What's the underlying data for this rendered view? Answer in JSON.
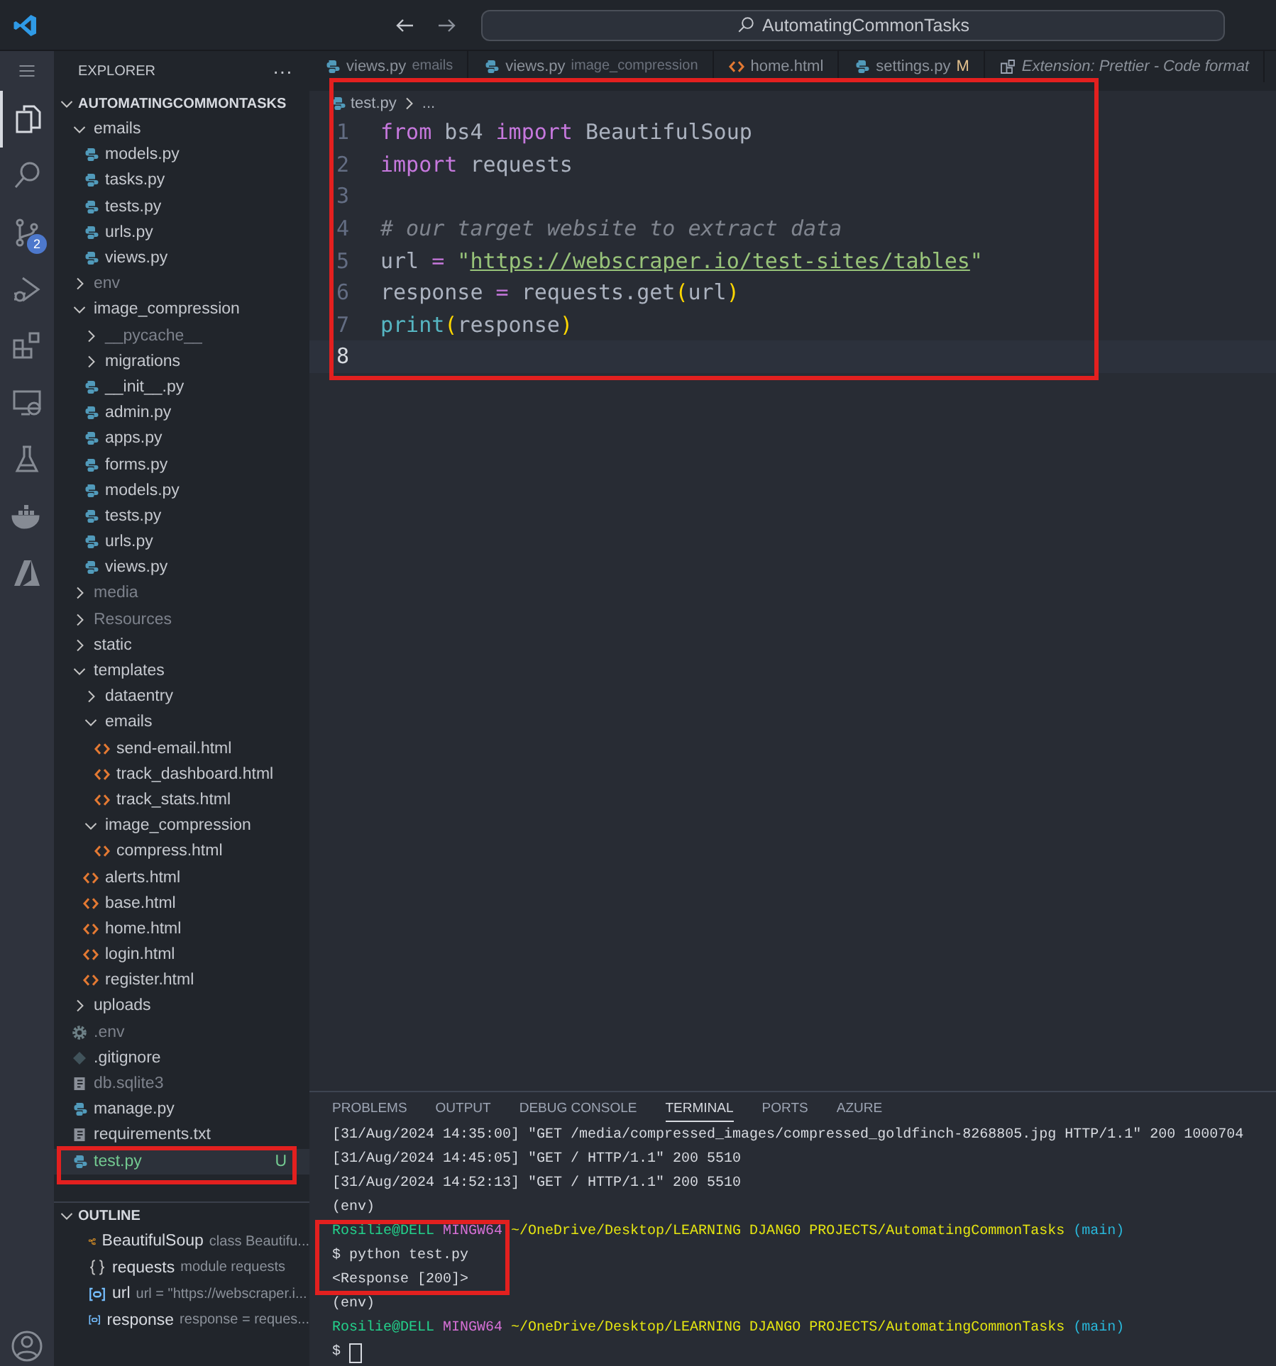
{
  "title_bar": {
    "search": "AutomatingCommonTasks"
  },
  "activity_bar": [
    {
      "kind": "explorer",
      "selected": true
    },
    {
      "kind": "search",
      "selected": false
    },
    {
      "kind": "source-control",
      "selected": false,
      "badge": "2"
    },
    {
      "kind": "run-debug",
      "selected": false
    },
    {
      "kind": "extensions",
      "selected": false
    },
    {
      "kind": "remote",
      "selected": false
    },
    {
      "kind": "testing",
      "selected": false
    },
    {
      "kind": "docker",
      "selected": false
    },
    {
      "kind": "azure",
      "selected": false
    }
  ],
  "sidebar": {
    "title": "EXPLORER",
    "more": "···",
    "folder": {
      "label": "AUTOMATINGCOMMONTASKS",
      "expanded": true
    },
    "tree": [
      {
        "label": "emails",
        "kind": "folder",
        "expanded": true,
        "dimmed": false,
        "selected": false,
        "children": [
          {
            "label": "models.py",
            "kind": "python",
            "dimmed": false,
            "selected": false
          },
          {
            "label": "tasks.py",
            "kind": "python",
            "dimmed": false,
            "selected": false
          },
          {
            "label": "tests.py",
            "kind": "python",
            "dimmed": false,
            "selected": false
          },
          {
            "label": "urls.py",
            "kind": "python",
            "dimmed": false,
            "selected": false
          },
          {
            "label": "views.py",
            "kind": "python",
            "dimmed": false,
            "selected": false
          }
        ]
      },
      {
        "label": "env",
        "kind": "folder",
        "expanded": false,
        "dimmed": true,
        "selected": false
      },
      {
        "label": "image_compression",
        "kind": "folder",
        "expanded": true,
        "dimmed": false,
        "selected": false,
        "children": [
          {
            "label": "__pycache__",
            "kind": "folder",
            "expanded": false,
            "dimmed": true,
            "selected": false
          },
          {
            "label": "migrations",
            "kind": "folder",
            "expanded": false,
            "dimmed": false,
            "selected": false
          },
          {
            "label": "__init__.py",
            "kind": "python",
            "dimmed": false,
            "selected": false
          },
          {
            "label": "admin.py",
            "kind": "python",
            "dimmed": false,
            "selected": false
          },
          {
            "label": "apps.py",
            "kind": "python",
            "dimmed": false,
            "selected": false
          },
          {
            "label": "forms.py",
            "kind": "python",
            "dimmed": false,
            "selected": false
          },
          {
            "label": "models.py",
            "kind": "python",
            "dimmed": false,
            "selected": false
          },
          {
            "label": "tests.py",
            "kind": "python",
            "dimmed": false,
            "selected": false
          },
          {
            "label": "urls.py",
            "kind": "python",
            "dimmed": false,
            "selected": false
          },
          {
            "label": "views.py",
            "kind": "python",
            "dimmed": false,
            "selected": false
          }
        ]
      },
      {
        "label": "media",
        "kind": "folder",
        "expanded": false,
        "dimmed": true,
        "selected": false
      },
      {
        "label": "Resources",
        "kind": "folder",
        "expanded": false,
        "dimmed": true,
        "selected": false
      },
      {
        "label": "static",
        "kind": "folder",
        "expanded": false,
        "dimmed": false,
        "selected": false
      },
      {
        "label": "templates",
        "kind": "folder",
        "expanded": true,
        "dimmed": false,
        "selected": false,
        "children": [
          {
            "label": "dataentry",
            "kind": "folder",
            "expanded": false,
            "dimmed": false,
            "selected": false
          },
          {
            "label": "emails",
            "kind": "folder",
            "expanded": true,
            "dimmed": false,
            "selected": false,
            "children": [
              {
                "label": "send-email.html",
                "kind": "html",
                "dimmed": false,
                "selected": false
              },
              {
                "label": "track_dashboard.html",
                "kind": "html",
                "dimmed": false,
                "selected": false
              },
              {
                "label": "track_stats.html",
                "kind": "html",
                "dimmed": false,
                "selected": false
              }
            ]
          },
          {
            "label": "image_compression",
            "kind": "folder",
            "expanded": true,
            "dimmed": false,
            "selected": false,
            "children": [
              {
                "label": "compress.html",
                "kind": "html",
                "dimmed": false,
                "selected": false
              }
            ]
          },
          {
            "label": "alerts.html",
            "kind": "html",
            "dimmed": false,
            "selected": false
          },
          {
            "label": "base.html",
            "kind": "html",
            "dimmed": false,
            "selected": false
          },
          {
            "label": "home.html",
            "kind": "html",
            "dimmed": false,
            "selected": false
          },
          {
            "label": "login.html",
            "kind": "html",
            "dimmed": false,
            "selected": false
          },
          {
            "label": "register.html",
            "kind": "html",
            "dimmed": false,
            "selected": false
          }
        ]
      },
      {
        "label": "uploads",
        "kind": "folder",
        "expanded": false,
        "dimmed": false,
        "selected": false
      },
      {
        "label": ".env",
        "kind": "settings",
        "dimmed": true,
        "selected": false
      },
      {
        "label": ".gitignore",
        "kind": "git",
        "dimmed": false,
        "selected": false
      },
      {
        "label": "db.sqlite3",
        "kind": "text",
        "dimmed": true,
        "selected": false
      },
      {
        "label": "manage.py",
        "kind": "python",
        "dimmed": false,
        "selected": false
      },
      {
        "label": "requirements.txt",
        "kind": "text",
        "dimmed": false,
        "selected": false
      },
      {
        "label": "test.py",
        "kind": "python",
        "dimmed": false,
        "selected": true,
        "badge": "U"
      }
    ],
    "outline": {
      "title": "OUTLINE",
      "expanded": true,
      "items": [
        {
          "kind": "class",
          "name": "BeautifulSoup",
          "detail": "class Beautifu..."
        },
        {
          "kind": "module",
          "name": "requests",
          "detail": "module requests"
        },
        {
          "kind": "variable",
          "name": "url",
          "detail": "url = \"https://webscraper.i..."
        },
        {
          "kind": "variable",
          "name": "response",
          "detail": "response = reques..."
        }
      ]
    }
  },
  "editor": {
    "tabs": [
      {
        "label": "views.py",
        "description": "emails",
        "kind": "python",
        "selected": false,
        "preview": false
      },
      {
        "label": "views.py",
        "description": "image_compression",
        "kind": "python",
        "selected": false,
        "preview": false
      },
      {
        "label": "home.html",
        "kind": "html",
        "selected": false,
        "preview": false
      },
      {
        "label": "settings.py",
        "badge": "M",
        "kind": "python",
        "selected": false,
        "preview": false
      },
      {
        "label": "Extension: Prettier - Code format",
        "kind": "extension",
        "selected": false,
        "preview": true
      }
    ],
    "breadcrumb": [
      "test.py",
      "..."
    ],
    "lines": [
      {
        "number": "1",
        "current": false,
        "tokens": [
          {
            "text": "from",
            "kind": "keyword"
          },
          {
            "text": " bs4 ",
            "kind": "plain"
          },
          {
            "text": "import",
            "kind": "keyword"
          },
          {
            "text": " BeautifulSoup",
            "kind": "plain"
          }
        ]
      },
      {
        "number": "2",
        "current": false,
        "tokens": [
          {
            "text": "import",
            "kind": "keyword"
          },
          {
            "text": " requests",
            "kind": "plain"
          }
        ]
      },
      {
        "number": "3",
        "current": false
      },
      {
        "number": "4",
        "current": false,
        "tokens": [
          {
            "text": "# our target website to extract data",
            "kind": "comment"
          }
        ]
      },
      {
        "number": "5",
        "current": false,
        "tokens": [
          {
            "text": "url ",
            "kind": "plain"
          },
          {
            "text": "=",
            "kind": "operator"
          },
          {
            "text": " \"",
            "kind": "string"
          },
          {
            "text": "https://webscraper.io/test-sites/tables",
            "kind": "link"
          },
          {
            "text": "\"",
            "kind": "string"
          }
        ]
      },
      {
        "number": "6",
        "current": false,
        "tokens": [
          {
            "text": "response ",
            "kind": "plain"
          },
          {
            "text": "=",
            "kind": "operator"
          },
          {
            "text": " requests.get",
            "kind": "plain"
          },
          {
            "text": "(",
            "kind": "bracket"
          },
          {
            "text": "url",
            "kind": "plain"
          },
          {
            "text": ")",
            "kind": "bracket"
          }
        ]
      },
      {
        "number": "7",
        "current": false,
        "tokens": [
          {
            "text": "print",
            "kind": "function"
          },
          {
            "text": "(",
            "kind": "bracket"
          },
          {
            "text": "response",
            "kind": "plain"
          },
          {
            "text": ")",
            "kind": "bracket"
          }
        ]
      },
      {
        "number": "8",
        "current": true
      }
    ]
  },
  "panel": {
    "tabs": [
      {
        "label": "PROBLEMS",
        "selected": false
      },
      {
        "label": "OUTPUT",
        "selected": false
      },
      {
        "label": "DEBUG CONSOLE",
        "selected": false
      },
      {
        "label": "TERMINAL",
        "selected": true
      },
      {
        "label": "PORTS",
        "selected": false
      },
      {
        "label": "AZURE",
        "selected": false
      }
    ],
    "terminal": [
      {
        "cursor": false,
        "segments": [
          {
            "text": "[31/Aug/2024 14:35:00] \"GET /media/compressed_images/compressed_goldfinch-8268805.jpg HTTP/1.1\" 200 1000704",
            "kind": "plain"
          }
        ]
      },
      {
        "cursor": false,
        "segments": [
          {
            "text": "[31/Aug/2024 14:45:05] \"GET / HTTP/1.1\" 200 5510",
            "kind": "plain"
          }
        ]
      },
      {
        "cursor": false,
        "segments": [
          {
            "text": "[31/Aug/2024 14:52:13] \"GET / HTTP/1.1\" 200 5510",
            "kind": "plain"
          }
        ]
      },
      {
        "cursor": false,
        "segments": [
          {
            "text": "(env)",
            "kind": "plain"
          }
        ]
      },
      {
        "cursor": false,
        "segments": [
          {
            "text": "Rosilie@DELL",
            "kind": "user"
          },
          {
            "text": " MINGW64",
            "kind": "host"
          },
          {
            "text": " ~/OneDrive/Desktop/LEARNING DJANGO PROJECTS/AutomatingCommonTasks",
            "kind": "path"
          },
          {
            "text": " (main)",
            "kind": "branch"
          }
        ]
      },
      {
        "cursor": false,
        "segments": [
          {
            "text": "$ python test.py",
            "kind": "plain"
          }
        ]
      },
      {
        "cursor": false,
        "segments": [
          {
            "text": "<Response [200]>",
            "kind": "plain"
          }
        ]
      },
      {
        "cursor": false,
        "segments": [
          {
            "text": "(env)",
            "kind": "plain"
          }
        ]
      },
      {
        "cursor": false,
        "segments": [
          {
            "text": "Rosilie@DELL",
            "kind": "user"
          },
          {
            "text": " MINGW64",
            "kind": "host"
          },
          {
            "text": " ~/OneDrive/Desktop/LEARNING DJANGO PROJECTS/AutomatingCommonTasks",
            "kind": "path"
          },
          {
            "text": " (main)",
            "kind": "branch"
          }
        ]
      },
      {
        "cursor": true,
        "segments": [
          {
            "text": "$",
            "kind": "plain"
          }
        ]
      }
    ]
  }
}
